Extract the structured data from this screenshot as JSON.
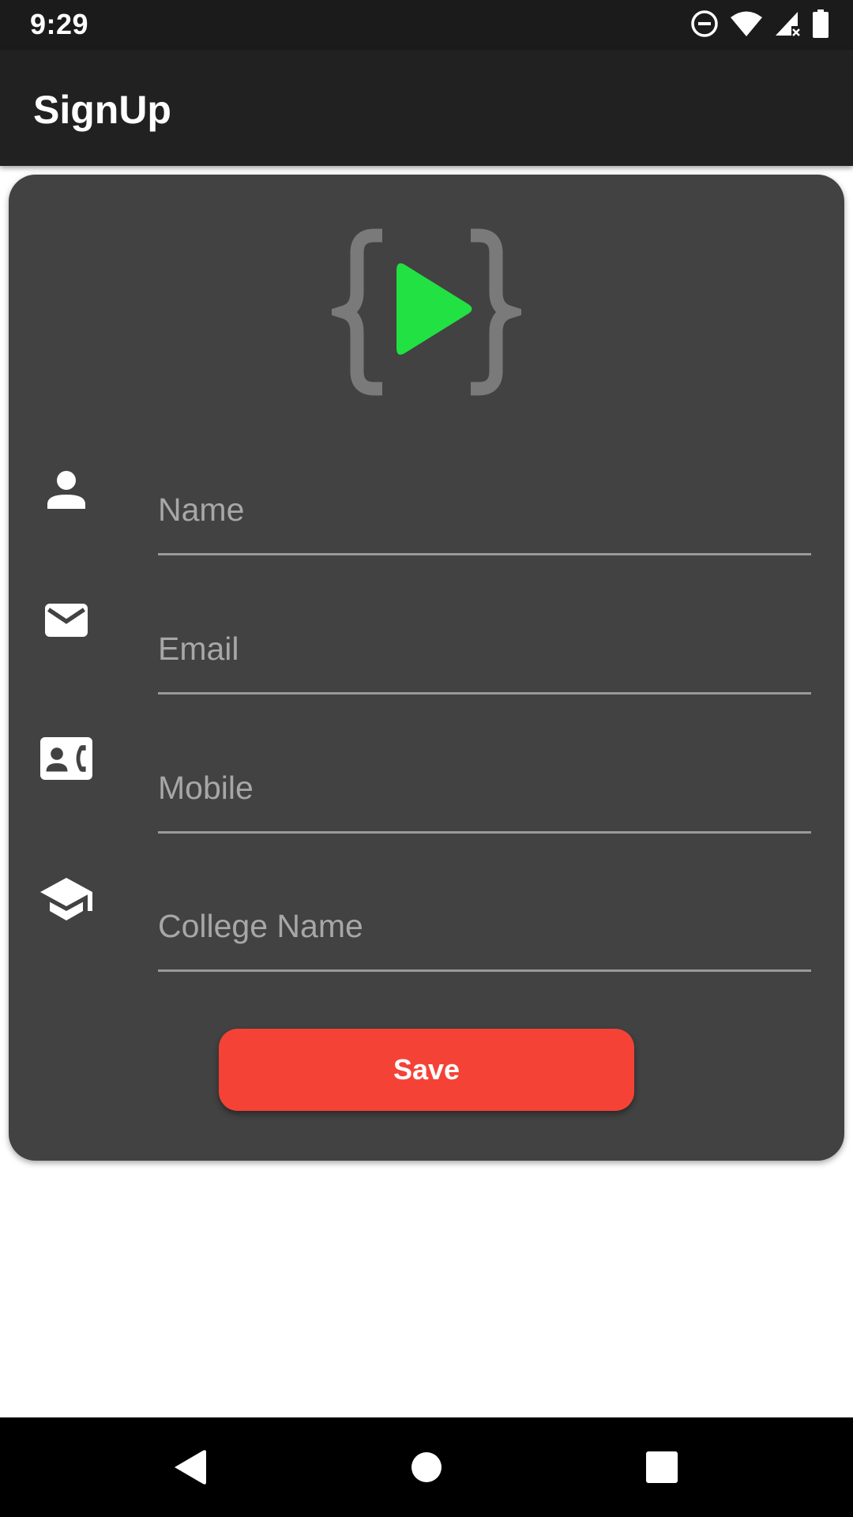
{
  "status_bar": {
    "time": "9:29",
    "icons": [
      "do-not-disturb-icon",
      "wifi-icon",
      "signal-icon",
      "battery-icon"
    ]
  },
  "app_bar": {
    "title": "SignUp"
  },
  "form": {
    "logo": "code-play-logo",
    "fields": [
      {
        "name": "name",
        "placeholder": "Name",
        "value": "",
        "icon": "person-icon"
      },
      {
        "name": "email",
        "placeholder": "Email",
        "value": "",
        "icon": "email-icon"
      },
      {
        "name": "mobile",
        "placeholder": "Mobile",
        "value": "",
        "icon": "contact-phone-icon"
      },
      {
        "name": "college",
        "placeholder": "College Name",
        "value": "",
        "icon": "school-icon"
      }
    ],
    "save_label": "Save"
  },
  "nav_bar": {
    "buttons": [
      "back-icon",
      "home-icon",
      "recents-icon"
    ]
  },
  "colors": {
    "status_bar": "#1b1b1b",
    "app_bar": "#212121",
    "card": "#424242",
    "accent_green": "#22e142",
    "logo_gray": "#7a7a7a",
    "save_button": "#f44336"
  }
}
